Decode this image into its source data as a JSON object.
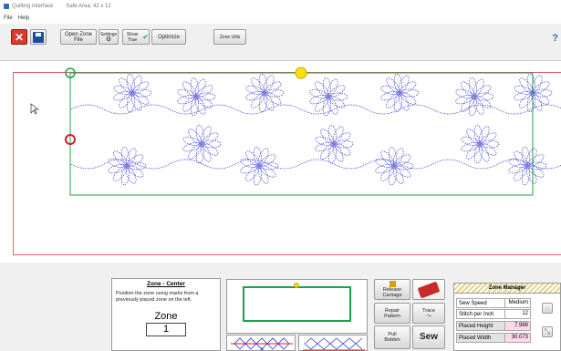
{
  "window": {
    "title": "Quilting Interface",
    "safe_area": "Safe Area: 42 x 12"
  },
  "menu": {
    "file": "File",
    "help": "Help"
  },
  "toolbar": {
    "open_label": "Open Zone File",
    "settings_label": "Settings",
    "show_true_label": "Show True",
    "optimize_label": "Optimize",
    "zone_utils_label": "Zone Utils",
    "help_symbol": "?"
  },
  "zone_panel": {
    "title": "Zone - Center",
    "description": "Position the zone using marks from a previously placed zone on the left.",
    "zone_label": "Zone",
    "zone_value": "1"
  },
  "actions": {
    "release_label": "Release Carriage",
    "repair_label": "Repair Pattern",
    "trace_label": "Trace",
    "pull_label": "Pull Bobbin",
    "sew_label": "Sew"
  },
  "zone_manager": {
    "title": "Zone Manager",
    "rows": [
      {
        "label": "Sew Speed",
        "value": "Medium"
      },
      {
        "label": "Stitch per Inch",
        "value": "12"
      },
      {
        "label": "Placed Height",
        "value": "7.988"
      },
      {
        "label": "Placed Width",
        "value": "30.073"
      }
    ]
  },
  "colors": {
    "stitch": "#3a3ad6",
    "zone_border": "#17a34a",
    "safe_border": "#e06070",
    "marker_yellow": "#ffe000",
    "marker_red": "#d42020",
    "marker_green": "#17a34a"
  }
}
